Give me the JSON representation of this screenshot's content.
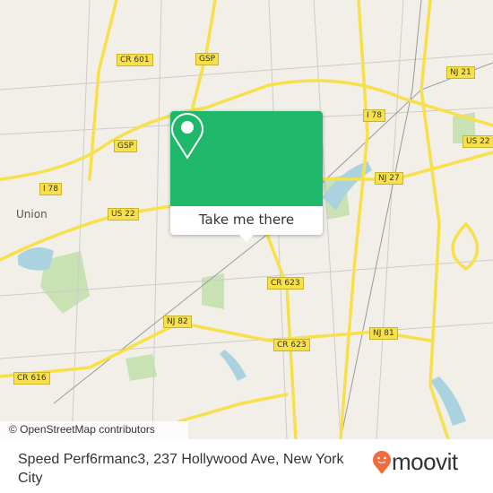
{
  "map": {
    "places": [
      {
        "name": "Union"
      }
    ],
    "shields": [
      "GSP",
      "CR 601",
      "I 78",
      "GSP",
      "US 22",
      "I 78",
      "NJ 21",
      "US 22",
      "NJ 27",
      "CR 623",
      "NJ 82",
      "CR 623",
      "NJ 81",
      "CR 616"
    ],
    "attribution": "© OpenStreetMap contributors",
    "colors": {
      "land": "#f2efe9",
      "road": "#f7e04a",
      "water": "#aad3df",
      "park": "#c8e2b4"
    }
  },
  "popup": {
    "button_label": "Take me there",
    "icon": "map-pin-icon",
    "color": "#1fb86b"
  },
  "footer": {
    "address": "Speed Perf6rmanc3, 237 Hollywood Ave, New York City",
    "logo_text": "moovit",
    "logo_color": "#f26a3d"
  }
}
